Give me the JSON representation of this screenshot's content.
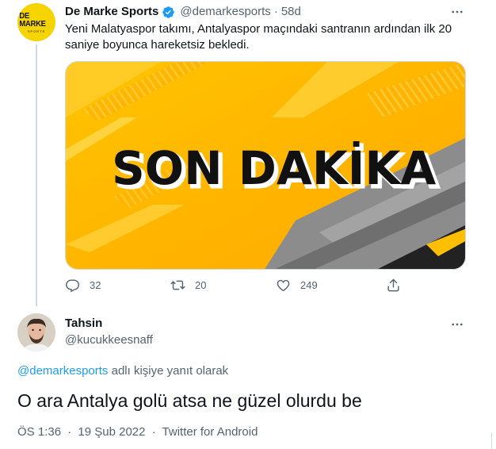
{
  "colors": {
    "brand_yellow": "#f6d400",
    "verified_blue": "#1d9bf0",
    "text_primary": "#0f1419",
    "text_secondary": "#536471",
    "link": "#1d9bf0"
  },
  "tweet": {
    "avatar_logo_main": "DE MARKE",
    "avatar_logo_sub": "SPORTS",
    "author_name": "De Marke Sports",
    "verified_icon": "verified-badge-icon",
    "handle": "@demarkesports",
    "separator": "·",
    "time": "58d",
    "text": "Yeni Malatyaspor takımı, Antalyaspor maçındaki santranın ardından ilk 20 saniye boyunca hareketsiz bekledi.",
    "image_headline": "SON DAKİKA",
    "actions": {
      "reply_count": "32",
      "retweet_count": "20",
      "like_count": "249"
    }
  },
  "reply": {
    "author_name": "Tahsin",
    "handle": "@kucukkeesnaff",
    "replying_to_mention": "@demarkesports",
    "replying_to_suffix": " adlı kişiye yanıt olarak",
    "text": "O ara Antalya golü atsa ne güzel olurdu be",
    "time": "ÖS 1:36",
    "separator": "·",
    "date": "19 Şub 2022",
    "source": "Twitter for Android"
  }
}
